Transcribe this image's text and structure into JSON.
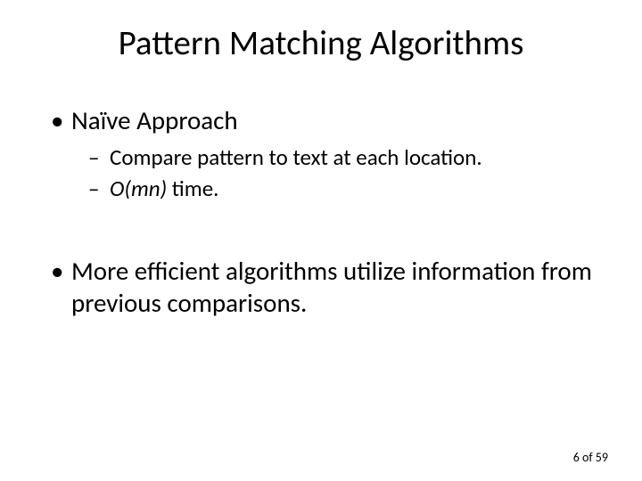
{
  "title": "Pattern Matching Algorithms",
  "bullets": {
    "b1": "Naïve Approach",
    "b1_1": "Compare pattern to text at each location.",
    "b1_2_italic": "O(mn)",
    "b1_2_rest": " time.",
    "b2": "More efficient algorithms utilize information from previous comparisons."
  },
  "footer": "6 of 59"
}
